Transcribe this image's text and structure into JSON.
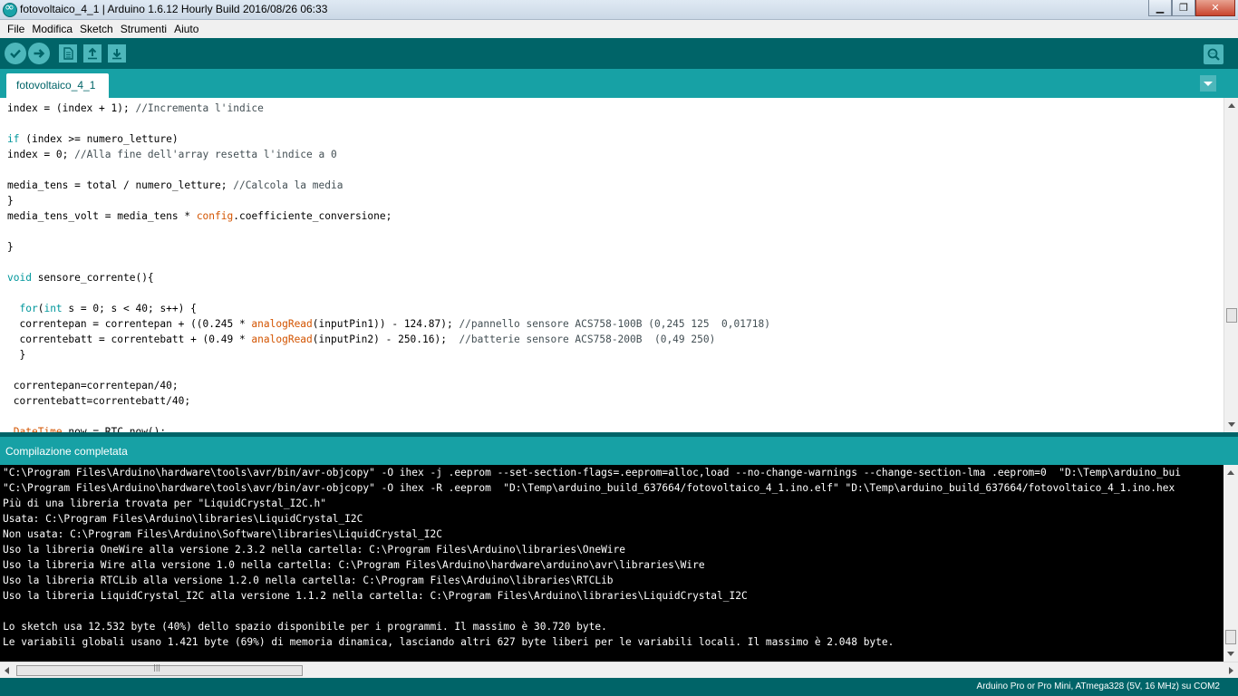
{
  "window": {
    "title": "fotovoltaico_4_1 | Arduino 1.6.12 Hourly Build 2016/08/26 06:33",
    "minimize": "▁",
    "maximize": "❐",
    "close": "✕"
  },
  "menu": {
    "items": [
      "File",
      "Modifica",
      "Sketch",
      "Strumenti",
      "Aiuto"
    ]
  },
  "toolbar": {
    "buttons": [
      "verify-icon",
      "upload-icon",
      "new-icon",
      "open-icon",
      "save-icon",
      "serial-monitor-icon"
    ]
  },
  "tab": {
    "label": "fotovoltaico_4_1"
  },
  "editor": {
    "lines": [
      [
        {
          "t": "index = (index + 1); "
        },
        {
          "t": "//Incrementa l'indice",
          "c": "cm"
        }
      ],
      [],
      [
        {
          "t": "if",
          "c": "kw"
        },
        {
          "t": " (index >= numero_letture)"
        }
      ],
      [
        {
          "t": "index = 0; "
        },
        {
          "t": "//Alla fine dell'array resetta l'indice a 0",
          "c": "cm"
        }
      ],
      [],
      [
        {
          "t": "media_tens = total / numero_letture; "
        },
        {
          "t": "//Calcola la media",
          "c": "cm"
        }
      ],
      [
        {
          "t": "}"
        }
      ],
      [
        {
          "t": "media_tens_volt = media_tens * "
        },
        {
          "t": "config",
          "c": "fn"
        },
        {
          "t": ".coefficiente_conversione;"
        }
      ],
      [],
      [
        {
          "t": "}"
        }
      ],
      [],
      [
        {
          "t": "void",
          "c": "kw"
        },
        {
          "t": " sensore_corrente(){"
        }
      ],
      [],
      [
        {
          "t": "  "
        },
        {
          "t": "for",
          "c": "kw"
        },
        {
          "t": "("
        },
        {
          "t": "int",
          "c": "kw"
        },
        {
          "t": " s = 0; s < 40; s++) {"
        }
      ],
      [
        {
          "t": "  correntepan = correntepan + ((0.245 * "
        },
        {
          "t": "analogRead",
          "c": "fn"
        },
        {
          "t": "(inputPin1)) - 124.87); "
        },
        {
          "t": "//pannello sensore ACS758-100B (0,245 125  0,01718)",
          "c": "cm"
        }
      ],
      [
        {
          "t": "  correntebatt = correntebatt + (0.49 * "
        },
        {
          "t": "analogRead",
          "c": "fn"
        },
        {
          "t": "(inputPin2) - 250.16);  "
        },
        {
          "t": "//batterie sensore ACS758-200B  (0,49 250)",
          "c": "cm"
        }
      ],
      [
        {
          "t": "  }"
        }
      ],
      [],
      [
        {
          "t": " correntepan=correntepan/40;"
        }
      ],
      [
        {
          "t": " correntebatt=correntebatt/40;"
        }
      ],
      [],
      [
        {
          "t": " "
        },
        {
          "t": "DateTime",
          "c": "fn"
        },
        {
          "t": " now = RTC.now();"
        }
      ]
    ]
  },
  "status": {
    "message": "Compilazione completata"
  },
  "console": {
    "lines": [
      "\"C:\\Program Files\\Arduino\\hardware\\tools\\avr/bin/avr-objcopy\" -O ihex -j .eeprom --set-section-flags=.eeprom=alloc,load --no-change-warnings --change-section-lma .eeprom=0  \"D:\\Temp\\arduino_bui",
      "\"C:\\Program Files\\Arduino\\hardware\\tools\\avr/bin/avr-objcopy\" -O ihex -R .eeprom  \"D:\\Temp\\arduino_build_637664/fotovoltaico_4_1.ino.elf\" \"D:\\Temp\\arduino_build_637664/fotovoltaico_4_1.ino.hex",
      "Più di una libreria trovata per \"LiquidCrystal_I2C.h\"",
      "Usata: C:\\Program Files\\Arduino\\libraries\\LiquidCrystal_I2C",
      "Non usata: C:\\Program Files\\Arduino\\Software\\libraries\\LiquidCrystal_I2C",
      "Uso la libreria OneWire alla versione 2.3.2 nella cartella: C:\\Program Files\\Arduino\\libraries\\OneWire",
      "Uso la libreria Wire alla versione 1.0 nella cartella: C:\\Program Files\\Arduino\\hardware\\arduino\\avr\\libraries\\Wire",
      "Uso la libreria RTCLib alla versione 1.2.0 nella cartella: C:\\Program Files\\Arduino\\libraries\\RTCLib",
      "Uso la libreria LiquidCrystal_I2C alla versione 1.1.2 nella cartella: C:\\Program Files\\Arduino\\libraries\\LiquidCrystal_I2C",
      "",
      "Lo sketch usa 12.532 byte (40%) dello spazio disponibile per i programmi. Il massimo è 30.720 byte.",
      "Le variabili globali usano 1.421 byte (69%) di memoria dinamica, lasciando altri 627 byte liberi per le variabili locali. Il massimo è 2.048 byte."
    ]
  },
  "bottombar": {
    "board": "Arduino Pro or Pro Mini, ATmega328 (5V, 16 MHz) su COM2"
  },
  "colors": {
    "toolbar": "#006468",
    "tabbar": "#17a1a5",
    "button": "#4db7bb",
    "keyword": "#00979c",
    "function": "#d35400",
    "comment": "#434f54"
  }
}
